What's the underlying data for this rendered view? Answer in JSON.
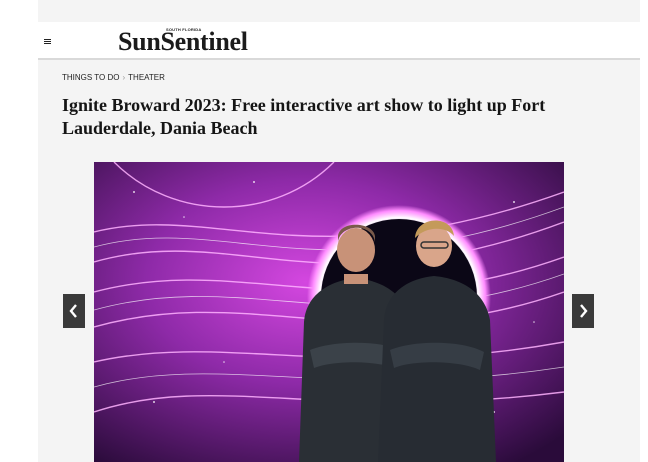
{
  "header": {
    "logo_tagline": "SOUTH FLORIDA",
    "logo_text": "SunSentinel"
  },
  "breadcrumb": {
    "section": "THINGS TO DO",
    "subsection": "THEATER"
  },
  "article": {
    "headline": "Ignite Broward 2023: Free interactive art show to light up Fort Lauderdale, Dania Beach"
  },
  "gallery": {
    "prev_icon": "chevron-left-icon",
    "next_icon": "chevron-right-icon"
  },
  "colors": {
    "accent": "#c936d6",
    "glow": "#ff6bff",
    "dark": "#2a0b3a"
  }
}
